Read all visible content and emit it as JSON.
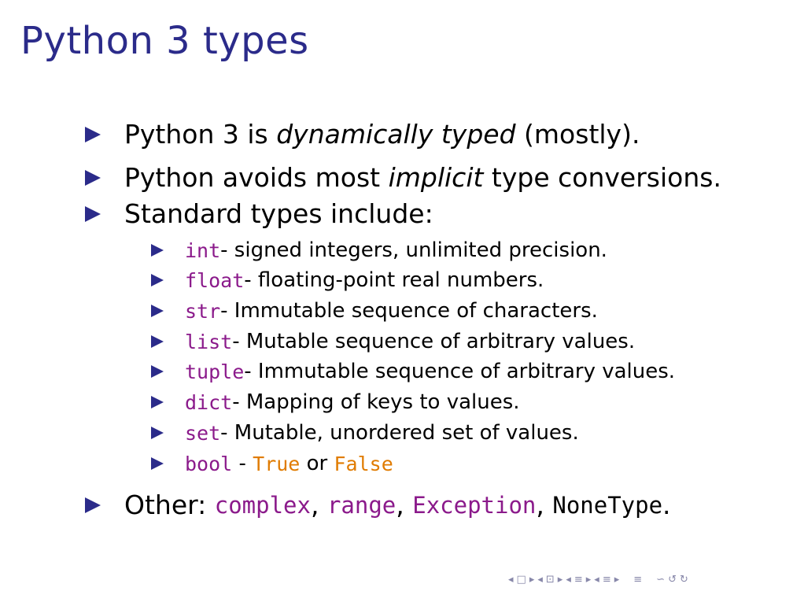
{
  "slide": {
    "title": "Python 3 types"
  },
  "bullets": {
    "b1": {
      "pre": "Python 3 is ",
      "em": "dynamically typed",
      "post": " (mostly)."
    },
    "b2": {
      "pre": "Python avoids most ",
      "em": "implicit",
      "post": " type conversions."
    },
    "b3": {
      "text": "Standard types include:"
    },
    "sub": [
      {
        "type": "int",
        "desc": " - signed integers, unlimited precision."
      },
      {
        "type": "float",
        "desc": " - floating-point real numbers."
      },
      {
        "type": "str",
        "desc": " - Immutable sequence of characters."
      },
      {
        "type": "list",
        "desc": " - Mutable sequence of arbitrary values."
      },
      {
        "type": "tuple",
        "desc": " - Immutable sequence of arbitrary values."
      },
      {
        "type": "dict",
        "desc": " - Mapping of keys to values."
      },
      {
        "type": "set",
        "desc": " - Mutable, unordered set of values."
      },
      {
        "type": "bool",
        "sep": " - ",
        "true": "True",
        "or": " or ",
        "false": "False"
      }
    ],
    "b4": {
      "pre": "Other: ",
      "t1": "complex",
      "c1": ", ",
      "t2": "range",
      "c2": ", ",
      "t3": "Exception",
      "c3": ", ",
      "t4": "NoneType",
      "end": "."
    }
  },
  "nav": {
    "first": "◂",
    "frame": "□",
    "next": "▸",
    "sub_prev": "◂",
    "sub_icon": "⊡",
    "sub_next": "▸",
    "sec_prev": "◂",
    "sec_icon": "≡",
    "sec_next": "▸",
    "ssec_prev": "◂",
    "ssec_icon": "≡",
    "ssec_next": "▸",
    "align": "≡",
    "search": "∽",
    "back": "↺",
    "fwd": "↻"
  }
}
